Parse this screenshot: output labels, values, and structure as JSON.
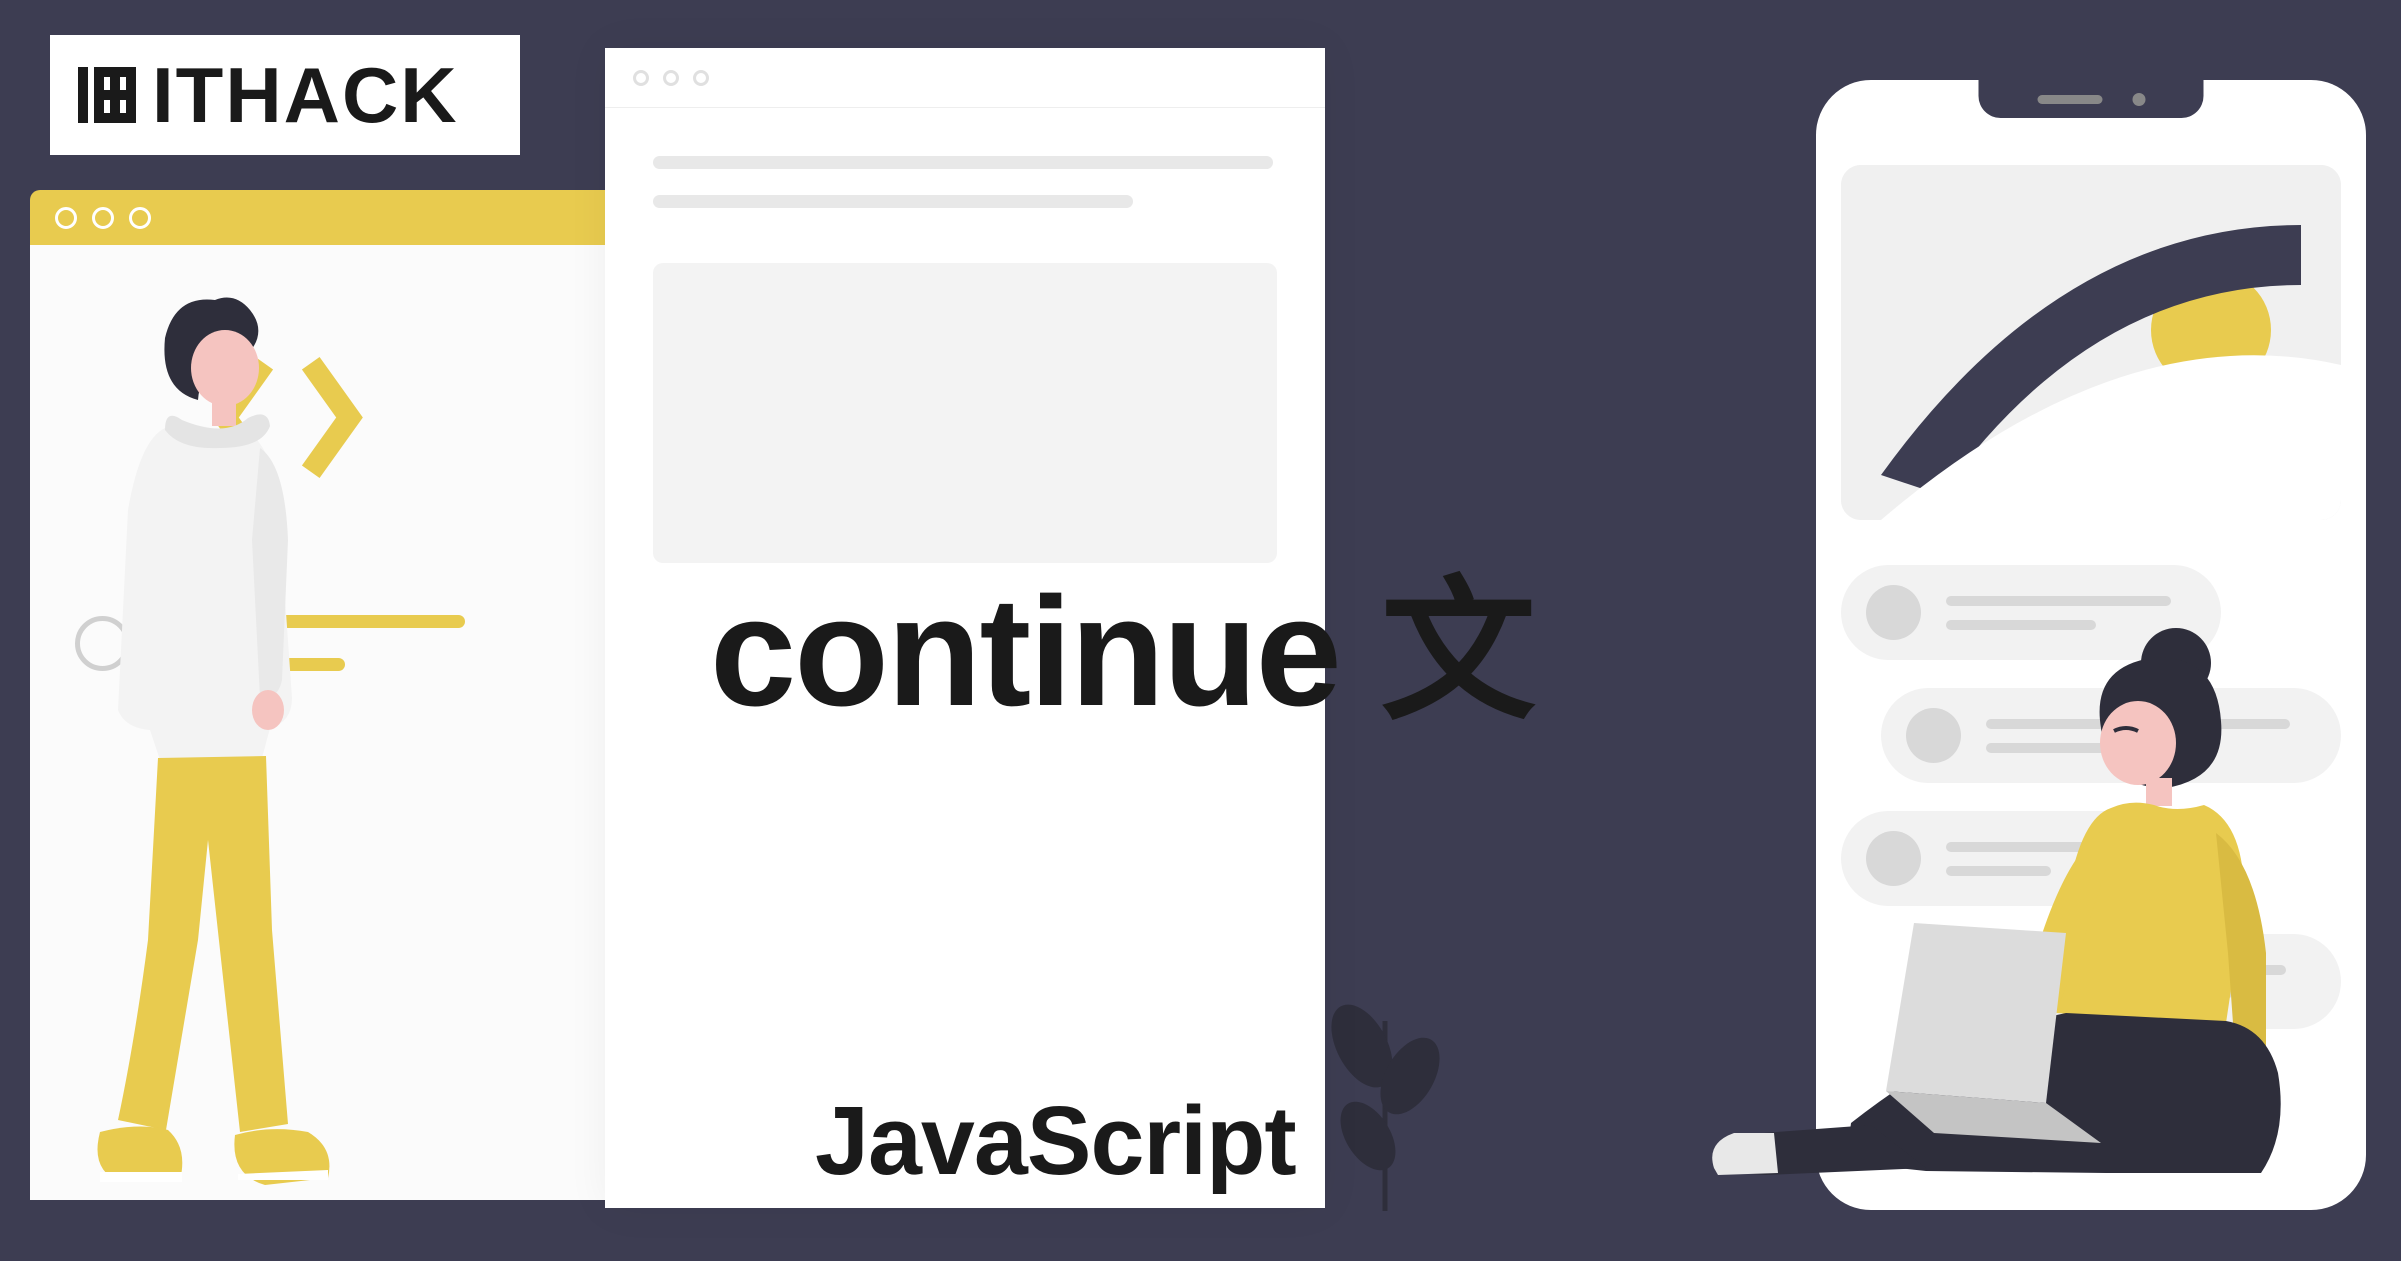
{
  "logo": {
    "text": "ITHACK"
  },
  "title": "continue 文",
  "subtitle": "JavaScript",
  "colors": {
    "background": "#3d3d52",
    "accent": "#e8cb4f",
    "skin": "#f5c4c0",
    "dark": "#2e2e3b"
  }
}
